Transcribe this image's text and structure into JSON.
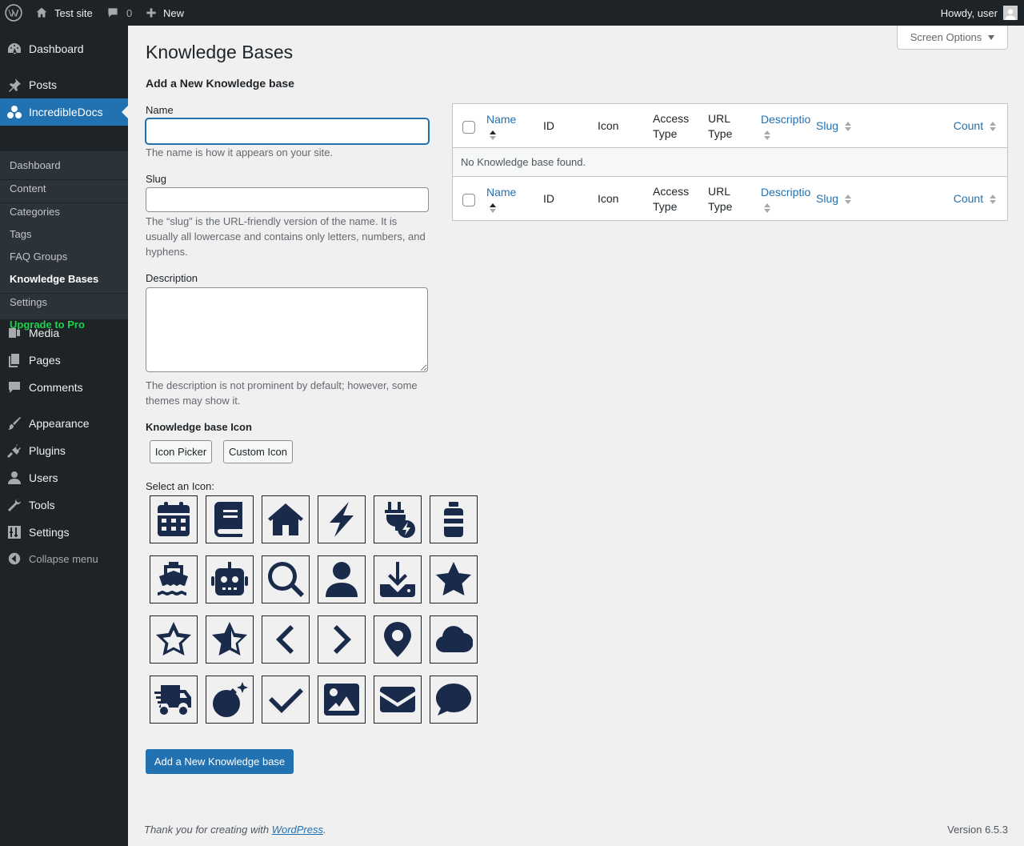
{
  "adminbar": {
    "site_name": "Test site",
    "comments_count": "0",
    "new_label": "New",
    "greeting": "Howdy, user"
  },
  "sidebar": {
    "top_items": [
      {
        "label": "Dashboard",
        "icon": "dashboard-icon"
      },
      {
        "label": "Posts",
        "icon": "pin-icon"
      },
      {
        "label": "IncredibleDocs",
        "icon": "incredibledocs-icon"
      },
      {
        "label": "Media",
        "icon": "media-icon"
      },
      {
        "label": "Pages",
        "icon": "pages-icon"
      },
      {
        "label": "Comments",
        "icon": "comments-icon"
      },
      {
        "label": "Appearance",
        "icon": "brush-icon"
      },
      {
        "label": "Plugins",
        "icon": "plugin-icon"
      },
      {
        "label": "Users",
        "icon": "users-icon"
      },
      {
        "label": "Tools",
        "icon": "wrench-icon"
      },
      {
        "label": "Settings",
        "icon": "settings-icon"
      }
    ],
    "submenu": [
      "Dashboard",
      "Content",
      "Categories",
      "Tags",
      "FAQ Groups",
      "Knowledge Bases",
      "Settings",
      "Upgrade to Pro"
    ],
    "collapse_label": "Collapse menu"
  },
  "screen_options": "Screen Options",
  "page_title": "Knowledge Bases",
  "form": {
    "title": "Add a New Knowledge base",
    "name_label": "Name",
    "name_value": "",
    "name_desc": "The name is how it appears on your site.",
    "slug_label": "Slug",
    "slug_value": "",
    "slug_desc": "The “slug” is the URL-friendly version of the name. It is usually all lowercase and contains only letters, numbers, and hyphens.",
    "description_label": "Description",
    "description_value": "",
    "description_desc": "The description is not prominent by default; however, some themes may show it.",
    "icon_label": "Knowledge base Icon",
    "icon_picker_button": "Icon Picker",
    "custom_icon_button": "Custom Icon",
    "select_icon_label": "Select an Icon:",
    "icons": [
      "calendar-icon",
      "book-icon",
      "home-icon",
      "bolt-icon",
      "plug-bolt-icon",
      "bottle-icon",
      "ship-icon",
      "robot-icon",
      "search-icon",
      "user-icon",
      "download-icon",
      "star-solid-icon",
      "star-outline-icon",
      "star-half-icon",
      "chevron-left-icon",
      "chevron-right-icon",
      "location-pin-icon",
      "cloud-icon",
      "truck-fast-icon",
      "bomb-icon",
      "check-icon",
      "image-icon",
      "envelope-icon",
      "comment-icon"
    ],
    "submit_button": "Add a New Knowledge base"
  },
  "table": {
    "columns": {
      "name": "Name",
      "id": "ID",
      "icon": "Icon",
      "access_type_1": "Access",
      "access_type_2": "Type",
      "url_type_1": "URL",
      "url_type_2": "Type",
      "description": "Descriptio",
      "slug": "Slug",
      "count": "Count"
    },
    "empty_message": "No Knowledge base found."
  },
  "footer": {
    "thanks_prefix": "Thank you for creating with ",
    "wordpress_link": "WordPress",
    "thanks_suffix": ".",
    "version": "Version 6.5.3"
  }
}
